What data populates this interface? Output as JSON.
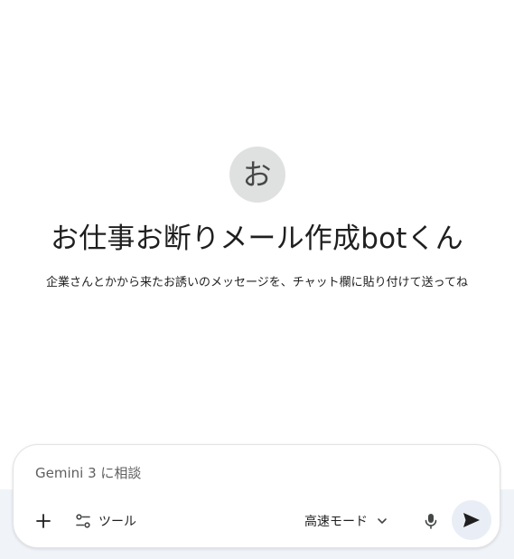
{
  "bot": {
    "avatar_char": "お",
    "title": "お仕事お断りメール作成botくん",
    "description": "企業さんとかから来たお誘いのメッセージを、チャット欄に貼り付けて送ってね"
  },
  "composer": {
    "placeholder": "Gemini 3 に相談",
    "value": "",
    "tools_label": "ツール",
    "mode_label": "高速モード"
  },
  "icons": {
    "add": "plus-icon",
    "tools": "tune-icon",
    "mode_dropdown": "chevron-down-icon",
    "mic": "microphone-icon",
    "send": "send-icon"
  },
  "colors": {
    "avatar_bg": "#dfe1e0",
    "send_bg": "#e9eef6",
    "bottom_band": "#f0f4f9"
  }
}
